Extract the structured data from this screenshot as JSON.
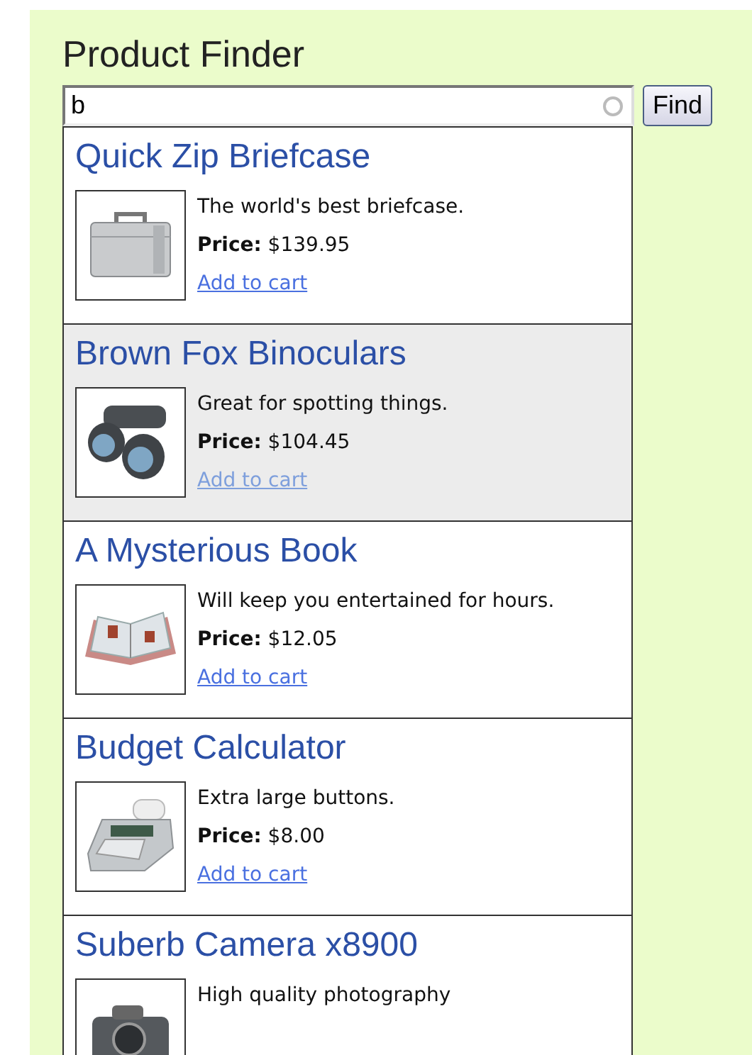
{
  "title": "Product Finder",
  "search": {
    "value": "b",
    "button": "Find"
  },
  "products": [
    {
      "name": "Quick Zip Briefcase",
      "kind": "briefcase",
      "description": "The world's best briefcase.",
      "price": "**Price:** $139.95",
      "link": "Add to cart",
      "selected": false
    },
    {
      "name": "Brown Fox Binoculars",
      "kind": "binoculars",
      "description": "Great for spotting things.",
      "price": "**Price:** $104.45",
      "link": "Add to cart",
      "selected": true
    },
    {
      "name": "A Mysterious Book",
      "kind": "book",
      "description": "Will keep you entertained for hours.",
      "price": "**Price:** $12.05",
      "link": "Add to cart",
      "selected": false
    },
    {
      "name": "Budget Calculator",
      "kind": "calculator",
      "description": "Extra large buttons.",
      "price": "**Price:** $8.00",
      "link": "Add to cart",
      "selected": false
    },
    {
      "name": "Suberb Camera x8900",
      "kind": "camera",
      "description": "High quality photography",
      "selected": false
    }
  ]
}
